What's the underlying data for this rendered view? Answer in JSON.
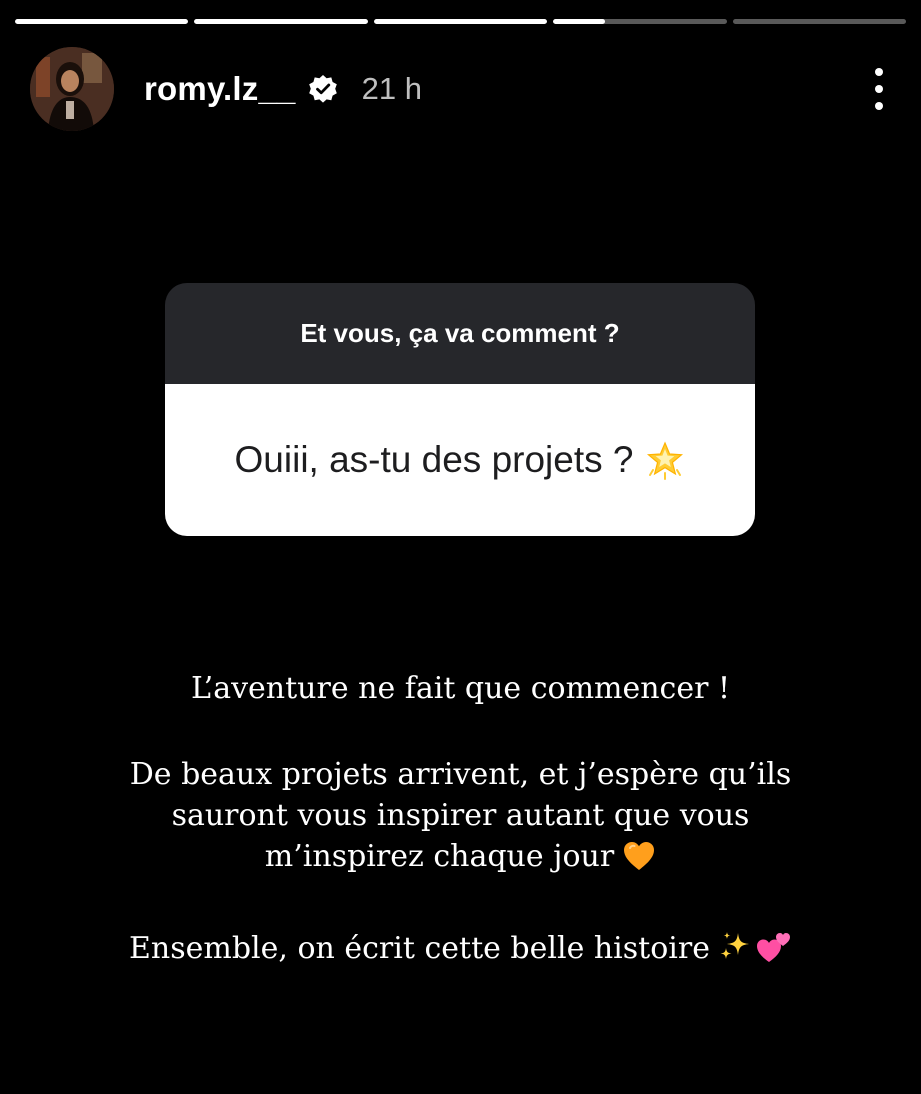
{
  "progress": [
    1,
    1,
    1,
    0.3,
    0
  ],
  "header": {
    "username": "romy.lz__",
    "time": "21 h",
    "verified_icon": "verified-badge-icon",
    "more_icon": "more-vertical-icon"
  },
  "question": {
    "prompt": "Et vous, ça va comment ?",
    "answer": "Ouiii, as-tu des projets ?",
    "answer_emoji": "glowing-star-icon"
  },
  "story": {
    "line1": "L’aventure ne fait que commencer !",
    "p2_line1": "De beaux projets arrivent, et j’espère qu’ils",
    "p2_line2": "sauront vous inspirer autant que vous",
    "p2_line3": "m’inspirez chaque jour",
    "p2_emoji": "orange-heart-icon",
    "line4": "Ensemble, on écrit cette belle histoire",
    "line4_emojis": [
      "sparkles-icon",
      "two-hearts-icon"
    ]
  },
  "colors": {
    "background": "#000000",
    "question_header": "#26272b",
    "question_body": "#ffffff",
    "accent_orange": "#ff9f1c",
    "accent_pink": "#ff4fa3"
  }
}
